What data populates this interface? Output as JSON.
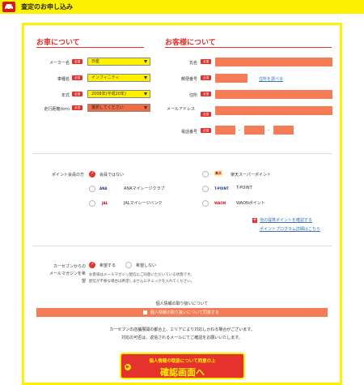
{
  "header": {
    "title": "査定のお申し込み"
  },
  "car": {
    "section_title": "お車について",
    "maker": {
      "label": "メーカー名",
      "value": "日産"
    },
    "model": {
      "label": "車種名",
      "value": "インフィニティ"
    },
    "year": {
      "label": "年式",
      "value": "2008年(平成20年)"
    },
    "mileage": {
      "label": "走行距離(km)",
      "value": "選択してください"
    }
  },
  "customer": {
    "section_title": "お客様について",
    "name_label": "氏名",
    "zip_label": "郵便番号",
    "zip_link": "住所を調べる",
    "address_label": "住所",
    "email_label": "メールアドレス",
    "phone_label": "電話番号",
    "phone_sep1": "-",
    "phone_sep2": "-"
  },
  "required": "必須",
  "points": {
    "label": "ポイント会員の方",
    "options": [
      {
        "label": "会員ではない"
      },
      {
        "label": "楽天スーパーポイント",
        "logo": "楽天"
      },
      {
        "label": "ANAマイレージクラブ",
        "logo": "ANA"
      },
      {
        "label": "T-POINT",
        "logo": "T-POINT"
      },
      {
        "label": "JALマイレージバンク",
        "logo": "JAL"
      },
      {
        "label": "WAONポイント",
        "logo": "WAON"
      }
    ],
    "link_other": "他の提携ポイントを確認する",
    "link_program": "ポイントプログラム詳細はこちら"
  },
  "magazine": {
    "label1": "カーセブンからの",
    "label2": "メールマガジンを希",
    "label3": "望",
    "opt_yes": "希望する",
    "opt_no": "希望しない",
    "note1": "お客様はメールマガジン配信にご同意いただいている状態です。",
    "note2": "配信が不要な場合は希望しませんにチェックを入れてください。"
  },
  "privacy": {
    "title": "個人情報の取り扱いについて",
    "checkbox_label": "個人情報の取り扱いについて同意する"
  },
  "notice": {
    "line1": "カーセブンの店舗展開の都合上、エリアにより対応しかねる場合がございます。",
    "line2": "対応の可否は、返信されるメールにてご確認をお願いいたします。"
  },
  "submit": {
    "line1": "個人情報の取扱について同意の上",
    "line2": "確認画面へ"
  },
  "colors": {
    "accent_yellow": "#fff100",
    "accent_red": "#e5322d",
    "input_orange": "#f47c56"
  }
}
